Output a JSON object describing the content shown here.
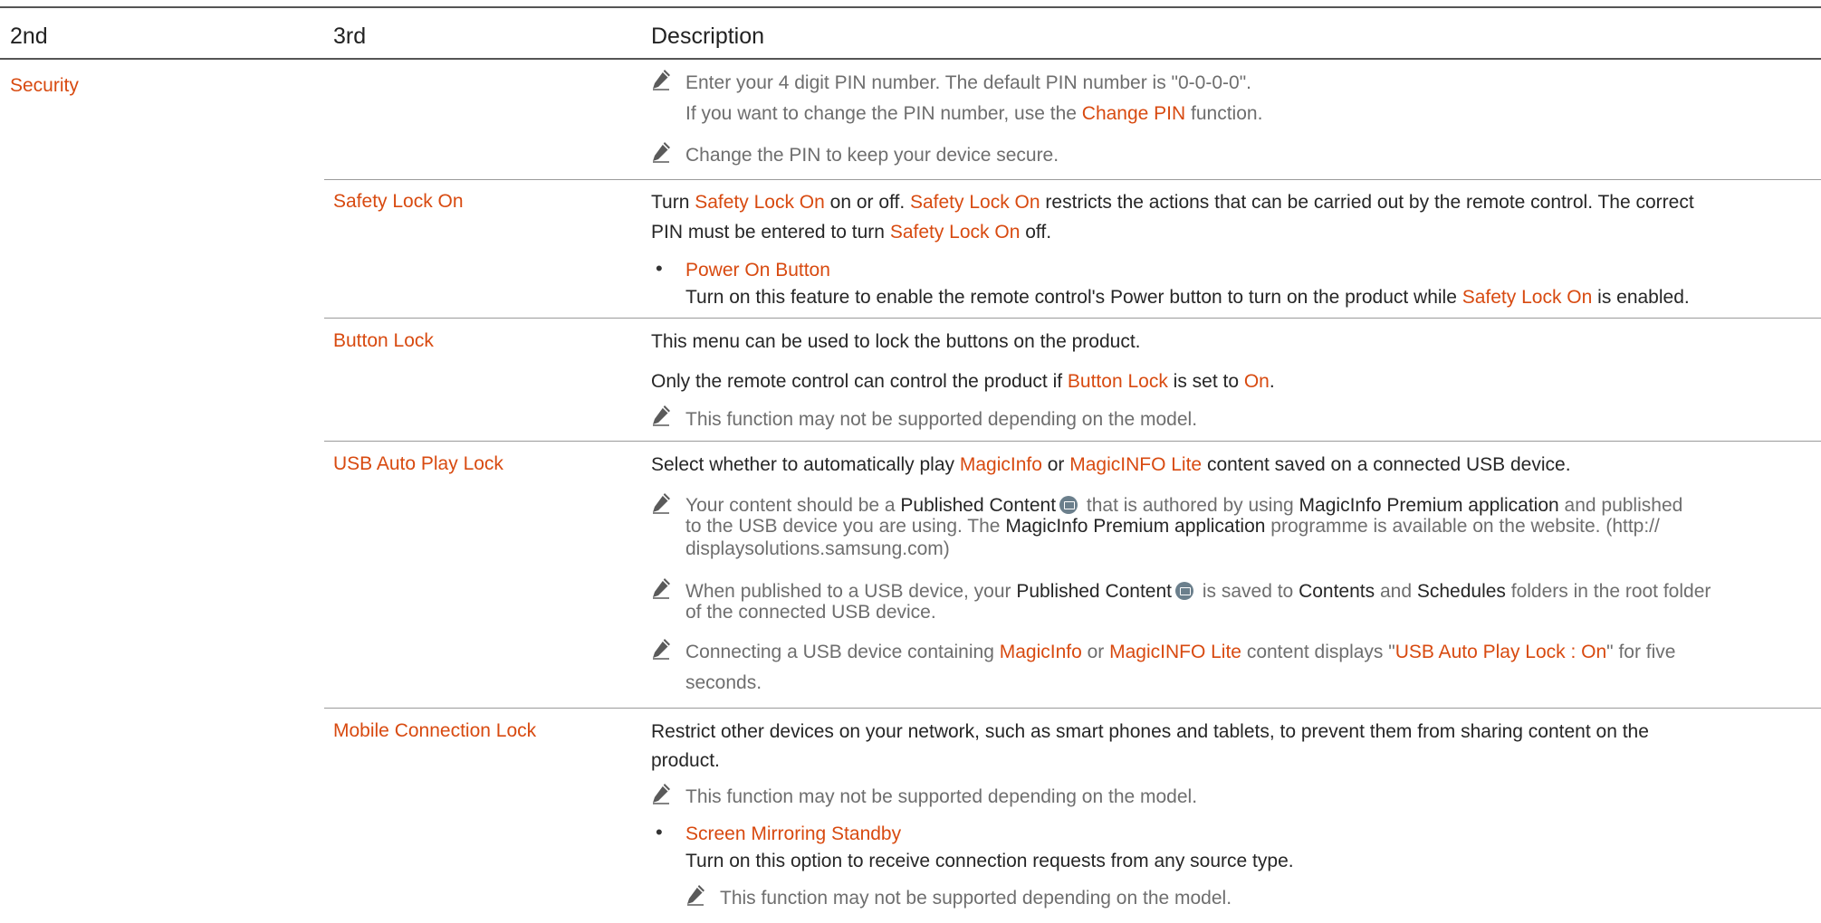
{
  "table": {
    "headers": [
      "2nd",
      "3rd",
      "Description"
    ],
    "category": "Security",
    "pin_notes": {
      "line1": "Enter your 4 digit PIN number. The default PIN number is \"0-0-0-0\".",
      "line2_pre": "If you want to change the PIN number, use the ",
      "line2_link": "Change PIN",
      "line2_post": " function.",
      "line3": "Change the PIN to keep your device secure."
    },
    "safety_lock": {
      "label": "Safety Lock On",
      "d1_a": "Turn ",
      "d1_b": "Safety Lock On",
      "d1_c": " on or off. ",
      "d1_d": "Safety Lock On",
      "d1_e": " restricts the actions that can be carried out by the remote control. The correct",
      "d2_a": "PIN must be entered to turn ",
      "d2_b": "Safety Lock On",
      "d2_c": " off.",
      "bullet_title": "Power On Button",
      "bullet_a": "Turn on this feature to enable the remote control's Power button to turn on the product while ",
      "bullet_b": "Safety Lock On",
      "bullet_c": " is enabled."
    },
    "button_lock": {
      "label": "Button Lock",
      "d1": "This menu can be used to lock the buttons on the product.",
      "d2_a": "Only the remote control can control the product if ",
      "d2_b": "Button Lock",
      "d2_c": " is set to ",
      "d2_d": "On",
      "d2_e": ".",
      "note": "This function may not be supported depending on the model."
    },
    "usb_lock": {
      "label": "USB Auto Play Lock",
      "d1_a": "Select whether to automatically play ",
      "d1_b": "MagicInfo",
      "d1_c": " or ",
      "d1_d": "MagicINFO Lite",
      "d1_e": " content saved on a connected USB device.",
      "n1_a": "Your content should be a ",
      "n1_b": "Published Content",
      "n1_c": " that is authored by using ",
      "n1_d": "MagicInfo Premium application",
      "n1_e": " and published",
      "n1_l2a": "to the USB device you are using. The ",
      "n1_l2b": "MagicInfo Premium application",
      "n1_l2c": " programme is available on the website. (http://",
      "n1_l3": "displaysolutions.samsung.com)",
      "n2_a": "When published to a USB device, your ",
      "n2_b": "Published Content",
      "n2_c": " is saved to ",
      "n2_d": "Contents",
      "n2_e": " and ",
      "n2_f": "Schedules",
      "n2_g": " folders in the root folder",
      "n2_l2": "of the connected USB device.",
      "n3_a": "Connecting a USB device containing ",
      "n3_b": "MagicInfo",
      "n3_c": " or ",
      "n3_d": "MagicINFO Lite",
      "n3_e": " content displays \"",
      "n3_f": "USB Auto Play Lock : On",
      "n3_g": "\" for five",
      "n3_l2": "seconds."
    },
    "mobile_lock": {
      "label": "Mobile Connection Lock",
      "d1": "Restrict other devices on your network, such as smart phones and tablets, to prevent them from sharing content on the",
      "d2": "product.",
      "note1": "This function may not be supported depending on the model.",
      "bullet_title": "Screen Mirroring Standby",
      "bullet_text": "Turn on this option to receive connection requests from any source type.",
      "note2": "This function may not be supported depending on the model."
    }
  }
}
